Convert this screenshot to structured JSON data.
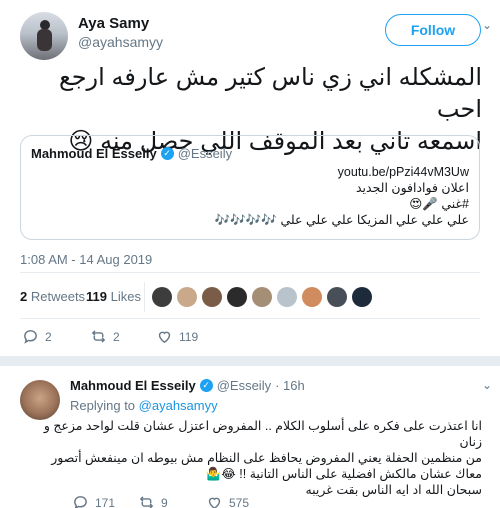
{
  "tweet": {
    "author_name": "Aya Samy",
    "author_handle": "@ayahsamyy",
    "follow_label": "Follow",
    "text_line1": "المشكله اني زي ناس كتير مش عارفه ارجع احب",
    "text_line2": "اسمعه تاني بعد الموقف اللي حصل منه 😢"
  },
  "quote": {
    "author_name": "Mahmoud El Esseily",
    "author_handle": "@Esseily",
    "line1": "youtu.be/pPzi44vM3Uw",
    "line2": "اعلان فوادافون الجديد",
    "line3": "#غني 🎤😍",
    "line4": "علي علي علي المزيكا علي علي علي 🎶🎶🎶🎶"
  },
  "timestamp": "1:08 AM - 14 Aug 2019",
  "stats": {
    "retweets_count": "2",
    "retweets_label": "Retweets",
    "likes_count": "119",
    "likes_label": "Likes"
  },
  "actions": {
    "reply_count": "2",
    "retweet_count": "2",
    "like_count": "119"
  },
  "reply": {
    "author_name": "Mahmoud El Esseily",
    "author_handle": "@Esseily",
    "time": "· 16h",
    "replying_prefix": "Replying to",
    "replying_to": "@ayahsamyy",
    "line1": "انا اعتذرت على فكره على أسلوب الكلام .. المفروض اعتزل عشان قلت لواحد مزعج و زنان",
    "line2": "من منظمين الحفلة يعني المفروض يحافظ على النظام مش بيوطه ان مينفعش أتصور",
    "line3": "معاك عشان مالكش افضلية على الناس التانية !! 😂🤷‍♂️",
    "line4": "سبحان الله اد ايه الناس بقت غريبه",
    "reply_count": "171",
    "retweet_count": "9",
    "like_count": "575"
  },
  "colors": {
    "accent": "#1da1f2",
    "muted": "#657786",
    "border": "#e6ecf0"
  }
}
